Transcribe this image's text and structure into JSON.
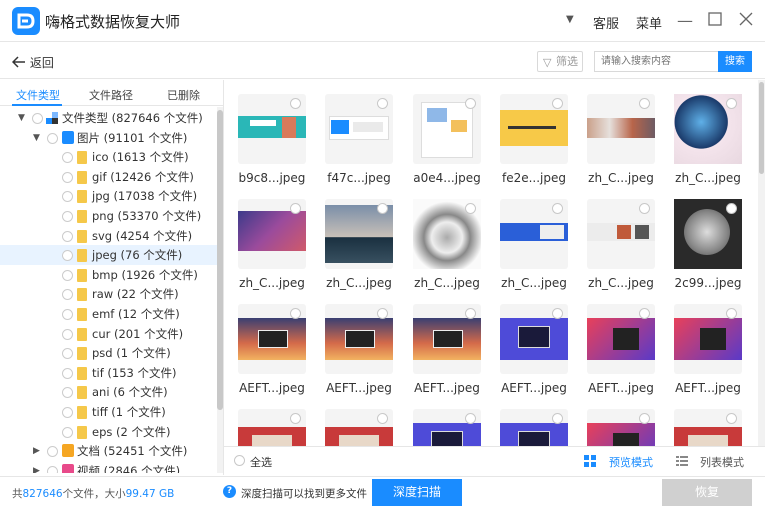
{
  "app": {
    "title": "嗨格式数据恢复大师"
  },
  "titlebar": {
    "dropdown_icon": "▼",
    "service": "客服",
    "menu": "菜单"
  },
  "toolbar": {
    "back_label": "返回",
    "filter_label": "筛选",
    "search_placeholder": "请输入搜索内容",
    "search_button": "搜索"
  },
  "tabs": [
    "文件类型",
    "文件路径",
    "已删除"
  ],
  "tree": [
    {
      "label": "文件类型 (827646 个文件)",
      "level": 0,
      "arrow": "▼",
      "icon": "root"
    },
    {
      "label": "图片 (91101 个文件)",
      "level": 1,
      "arrow": "▼",
      "icon": "image-category"
    },
    {
      "label": "ico (1613 个文件)",
      "level": 2,
      "icon": "folder"
    },
    {
      "label": "gif (12426 个文件)",
      "level": 2,
      "icon": "folder"
    },
    {
      "label": "jpg (17038 个文件)",
      "level": 2,
      "icon": "folder"
    },
    {
      "label": "png (53370 个文件)",
      "level": 2,
      "icon": "folder"
    },
    {
      "label": "svg (4254 个文件)",
      "level": 2,
      "icon": "folder"
    },
    {
      "label": "jpeg (76 个文件)",
      "level": 2,
      "icon": "folder",
      "selected": true
    },
    {
      "label": "bmp (1926 个文件)",
      "level": 2,
      "icon": "folder"
    },
    {
      "label": "raw (22 个文件)",
      "level": 2,
      "icon": "folder"
    },
    {
      "label": "emf (12 个文件)",
      "level": 2,
      "icon": "folder"
    },
    {
      "label": "cur (201 个文件)",
      "level": 2,
      "icon": "folder"
    },
    {
      "label": "psd (1 个文件)",
      "level": 2,
      "icon": "folder"
    },
    {
      "label": "tif (153 个文件)",
      "level": 2,
      "icon": "folder"
    },
    {
      "label": "ani (6 个文件)",
      "level": 2,
      "icon": "folder"
    },
    {
      "label": "tiff (1 个文件)",
      "level": 2,
      "icon": "folder"
    },
    {
      "label": "eps (2 个文件)",
      "level": 2,
      "icon": "folder"
    },
    {
      "label": "文档 (52451 个文件)",
      "level": 1,
      "arrow": "▶",
      "icon": "document-category"
    },
    {
      "label": "视频 (2846 个文件)",
      "level": 1,
      "arrow": "▶",
      "icon": "video-category"
    }
  ],
  "files": [
    {
      "name": "b9c8...jpeg",
      "thumb": "banner-teal"
    },
    {
      "name": "f47c...jpeg",
      "thumb": "webpage-screenshot"
    },
    {
      "name": "a0e4...jpeg",
      "thumb": "white-doc"
    },
    {
      "name": "fe2e...jpeg",
      "thumb": "yellow-banner"
    },
    {
      "name": "zh_C...jpeg",
      "thumb": "photo-strip"
    },
    {
      "name": "zh_C...jpeg",
      "thumb": "robot-head"
    },
    {
      "name": "zh_C...jpeg",
      "thumb": "purple-art"
    },
    {
      "name": "zh_C...jpeg",
      "thumb": "seaside-sky"
    },
    {
      "name": "zh_C...jpeg",
      "thumb": "mechanical-gray"
    },
    {
      "name": "zh_C...jpeg",
      "thumb": "blue-web-banner"
    },
    {
      "name": "zh_C...jpeg",
      "thumb": "product-strip"
    },
    {
      "name": "2c99...jpeg",
      "thumb": "hard-drive"
    },
    {
      "name": "AEFT...jpeg",
      "thumb": "sunset-laptop"
    },
    {
      "name": "AEFT...jpeg",
      "thumb": "sunset-laptop"
    },
    {
      "name": "AEFT...jpeg",
      "thumb": "sunset-laptop"
    },
    {
      "name": "AEFT...jpeg",
      "thumb": "blue-laptop"
    },
    {
      "name": "AEFT...jpeg",
      "thumb": "pink-graphic"
    },
    {
      "name": "AEFT...jpeg",
      "thumb": "pink-graphic"
    },
    {
      "name": "",
      "thumb": "red-partial"
    },
    {
      "name": "",
      "thumb": "red-partial"
    },
    {
      "name": "",
      "thumb": "blue-laptop"
    },
    {
      "name": "",
      "thumb": "blue-laptop"
    },
    {
      "name": "",
      "thumb": "pink-graphic"
    },
    {
      "name": "",
      "thumb": "red-partial"
    }
  ],
  "bottom": {
    "select_all": "全选",
    "preview_mode": "预览模式",
    "list_mode": "列表模式"
  },
  "status": {
    "prefix": "共",
    "count": "827646",
    "mid": "个文件，大小",
    "size": "99.47 GB",
    "hint": "深度扫描可以找到更多文件",
    "deep_scan": "深度扫描",
    "recover": "恢复"
  },
  "colors": {
    "accent": "#1a8cff",
    "folder": "#f5c84a",
    "disabled": "#d0d0d0"
  }
}
